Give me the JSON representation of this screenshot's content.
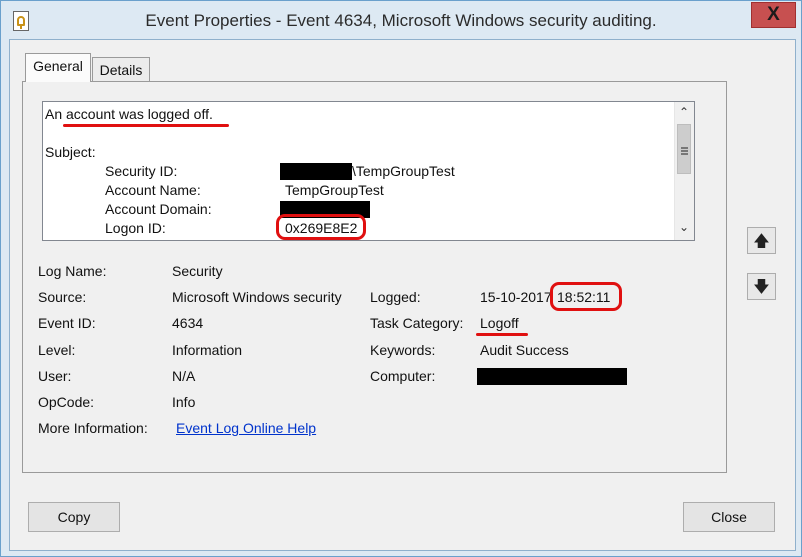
{
  "window": {
    "title": "Event Properties - Event 4634, Microsoft Windows security auditing.",
    "close_glyph": "X"
  },
  "tabs": [
    {
      "label": "General",
      "active": true
    },
    {
      "label": "Details",
      "active": false
    }
  ],
  "description": {
    "line1": "An account was logged off.",
    "subject_label": "Subject:",
    "fields": [
      {
        "label": "Security ID:",
        "value": "\\TempGroupTest"
      },
      {
        "label": "Account Name:",
        "value": "TempGroupTest"
      },
      {
        "label": "Account Domain:",
        "value": ""
      },
      {
        "label": "Logon ID:",
        "value": "0x269E8E2"
      }
    ]
  },
  "details": {
    "log_name": {
      "label": "Log Name:",
      "value": "Security"
    },
    "source": {
      "label": "Source:",
      "value": "Microsoft Windows security"
    },
    "logged": {
      "label": "Logged:",
      "date": "15-10-2017",
      "time": "18:52:11"
    },
    "event_id": {
      "label": "Event ID:",
      "value": "4634"
    },
    "task_category": {
      "label": "Task Category:",
      "value": "Logoff"
    },
    "level": {
      "label": "Level:",
      "value": "Information"
    },
    "keywords": {
      "label": "Keywords:",
      "value": "Audit Success"
    },
    "user": {
      "label": "User:",
      "value": "N/A"
    },
    "computer": {
      "label": "Computer:",
      "value": ""
    },
    "opcode": {
      "label": "OpCode:",
      "value": "Info"
    },
    "more_info": {
      "label": "More Information:",
      "link": "Event Log Online Help"
    }
  },
  "buttons": {
    "copy": "Copy",
    "close": "Close",
    "prev_icon": "arrow-up-icon",
    "next_icon": "arrow-down-icon"
  },
  "colors": {
    "annotation_red": "#e01010",
    "link_blue": "#0033cc",
    "close_button": "#c75050"
  }
}
